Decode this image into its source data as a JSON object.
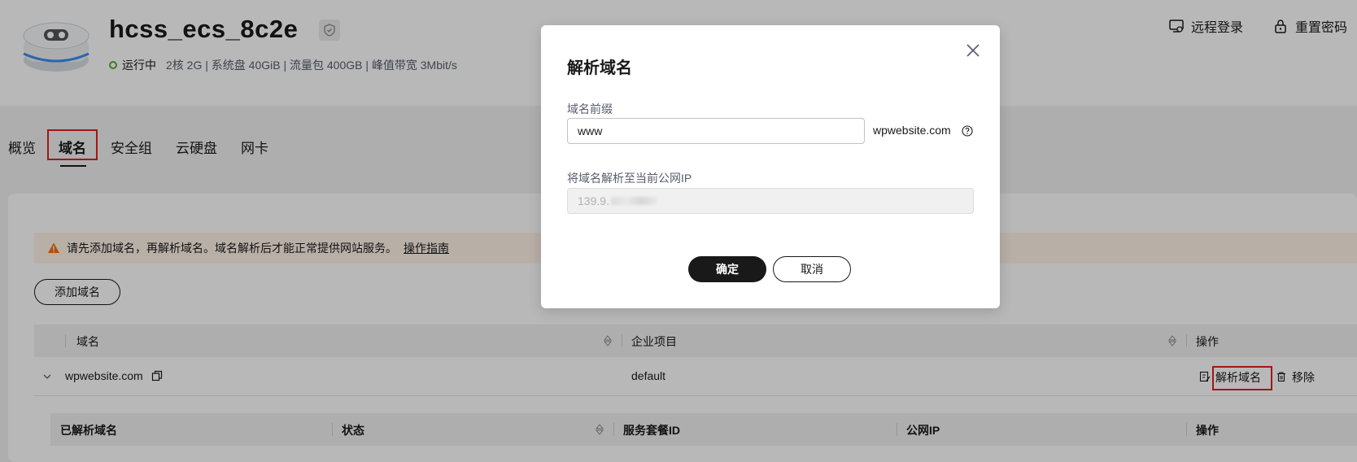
{
  "header": {
    "title": "hcss_ecs_8c2e",
    "status": "运行中",
    "specs": "2核  2G | 系统盘 40GiB | 流量包 400GB | 峰值带宽 3Mbit/s",
    "actions": [
      {
        "label": "远程登录",
        "icon": "remote-login-icon"
      },
      {
        "label": "重置密码",
        "icon": "lock-icon"
      }
    ]
  },
  "tabs": [
    {
      "label": "概览"
    },
    {
      "label": "域名",
      "active": true
    },
    {
      "label": "安全组"
    },
    {
      "label": "云硬盘"
    },
    {
      "label": "网卡"
    }
  ],
  "notice": {
    "text": "请先添加域名，再解析域名。域名解析后才能正常提供网站服务。",
    "link": "操作指南"
  },
  "add_button": "添加域名",
  "table": {
    "columns": [
      "域名",
      "企业项目",
      "操作"
    ],
    "rows": [
      {
        "domain": "wpwebsite.com",
        "project": "default",
        "actions": [
          "解析域名",
          "移除"
        ]
      }
    ],
    "sub_columns": [
      "已解析域名",
      "状态",
      "服务套餐ID",
      "公网IP",
      "操作"
    ]
  },
  "dialog": {
    "title": "解析域名",
    "prefix_label": "域名前缀",
    "prefix_value": "www",
    "suffix": "wpwebsite.com",
    "ip_label": "将域名解析至当前公网IP",
    "ip_value": "139.9.",
    "ok_label": "确定",
    "cancel_label": "取消"
  },
  "colors": {
    "accent": "#191919",
    "status_green": "#50b12e",
    "highlight_red": "#e0201d",
    "notice_bg": "#fff3e8"
  }
}
